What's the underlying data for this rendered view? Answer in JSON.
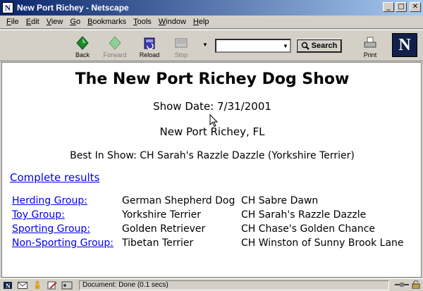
{
  "window": {
    "title": "New Port Richey - Netscape",
    "minimize_glyph": "_",
    "maximize_glyph": "□",
    "close_glyph": "✕"
  },
  "menu": [
    {
      "label": "File",
      "underline": "F",
      "rest": "ile"
    },
    {
      "label": "Edit",
      "underline": "E",
      "rest": "dit"
    },
    {
      "label": "View",
      "underline": "V",
      "rest": "iew"
    },
    {
      "label": "Go",
      "underline": "G",
      "rest": "o"
    },
    {
      "label": "Bookmarks",
      "underline": "B",
      "rest": "ookmarks"
    },
    {
      "label": "Tools",
      "underline": "T",
      "rest": "ools"
    },
    {
      "label": "Window",
      "underline": "W",
      "rest": "indow"
    },
    {
      "label": "Help",
      "underline": "H",
      "rest": "elp"
    }
  ],
  "toolbar": {
    "back_label": "Back",
    "forward_label": "Forward",
    "reload_label": "Reload",
    "stop_label": "Stop",
    "search_label": "Search",
    "print_label": "Print",
    "url_value": "",
    "logo_letter": "N"
  },
  "page": {
    "title": "The New Port Richey Dog Show",
    "show_date": "Show Date: 7/31/2001",
    "location": "New Port Richey, FL",
    "best_in_show": "Best In Show: CH Sarah's Razzle Dazzle (Yorkshire Terrier)",
    "complete_results_link": "Complete results",
    "groups": [
      {
        "group": "Herding Group:",
        "breed": "German Shepherd Dog",
        "winner": "CH Sabre Dawn"
      },
      {
        "group": "Toy Group:",
        "breed": "Yorkshire Terrier",
        "winner": "CH Sarah's Razzle Dazzle"
      },
      {
        "group": "Sporting Group:",
        "breed": "Golden Retriever",
        "winner": "CH Chase's Golden Chance"
      },
      {
        "group": "Non-Sporting Group:",
        "breed": "Tibetan Terrier",
        "winner": "CH Winston of Sunny Brook Lane"
      }
    ]
  },
  "status": {
    "text": "Document: Done (0.1 secs)"
  },
  "colors": {
    "link": "#0000ee",
    "titlebar_start": "#0a246a",
    "chrome": "#d4d0c8"
  }
}
